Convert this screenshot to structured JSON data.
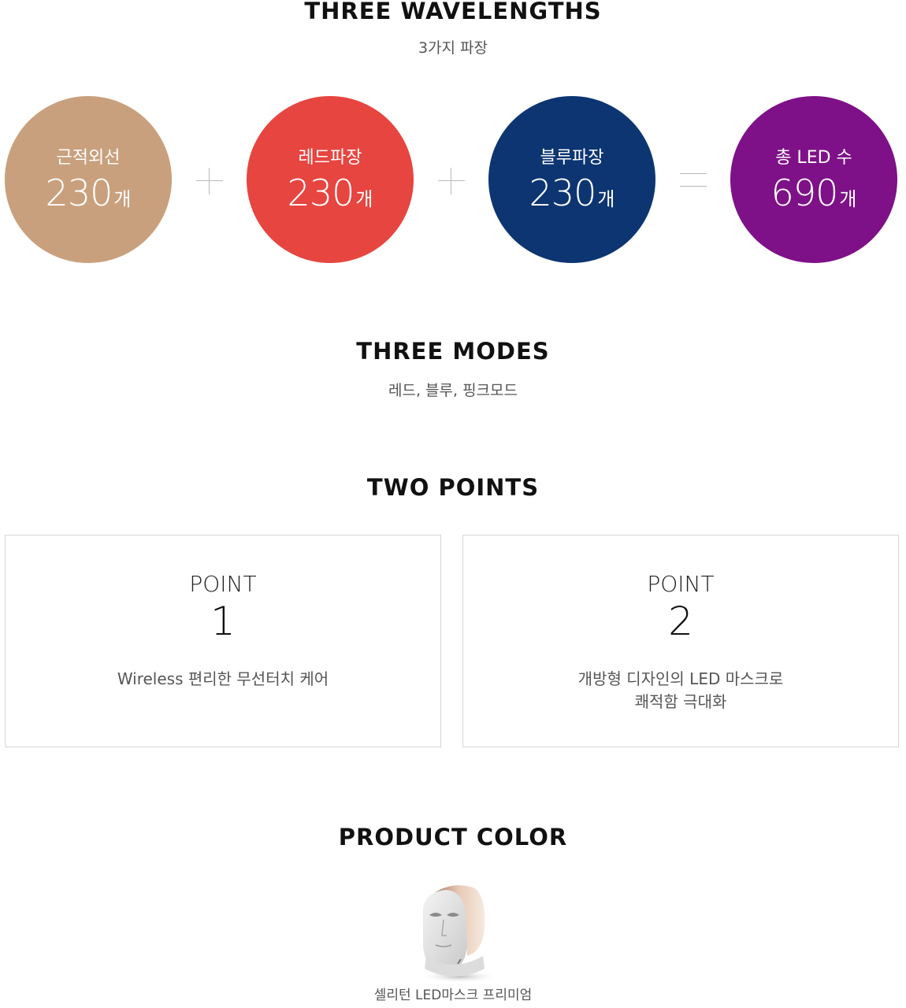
{
  "wavelengths": {
    "title": "THREE WAVELENGTHS",
    "subtitle": "3가지 파장",
    "items": [
      {
        "label": "근적외선",
        "value": "230",
        "unit": "개",
        "color": "#c9a07d"
      },
      {
        "label": "레드파장",
        "value": "230",
        "unit": "개",
        "color": "#e74540"
      },
      {
        "label": "블루파장",
        "value": "230",
        "unit": "개",
        "color": "#0d3572"
      },
      {
        "label": "총 LED 수",
        "value": "690",
        "unit": "개",
        "color": "#7e1088"
      }
    ],
    "operators": [
      "plus-icon",
      "plus-icon",
      "equals-icon"
    ]
  },
  "modes": {
    "title": "THREE MODES",
    "subtitle": "레드, 블루, 핑크모드"
  },
  "points": {
    "title": "TWO POINTS",
    "items": [
      {
        "label": "POINT",
        "number": "1",
        "description": "Wireless 편리한 무선터치 케어"
      },
      {
        "label": "POINT",
        "number": "2",
        "description": "개방형 디자인의 LED 마스크로\n쾌적함 극대화"
      }
    ]
  },
  "product_color": {
    "title": "PRODUCT COLOR",
    "product_name": "셀리턴 LED마스크 프리미엄",
    "product_icon": "led-mask-image"
  }
}
